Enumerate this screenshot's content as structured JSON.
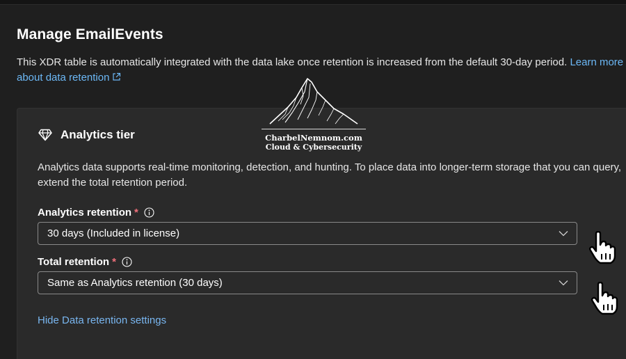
{
  "page": {
    "title": "Manage EmailEvents",
    "description": "This XDR table is automatically integrated with the data lake once retention is increased from the default 30-day period.",
    "learn_more_link": "Learn more about data retention"
  },
  "logo": {
    "line1": "CharbelNemnom.com",
    "line2": "Cloud & Cybersecurity"
  },
  "analytics": {
    "title": "Analytics tier",
    "description": "Analytics data supports real-time monitoring, detection, and hunting. To place data into longer-term storage that you can query, extend the total retention period.",
    "analytics_retention": {
      "label": "Analytics retention",
      "required_mark": "*",
      "value": "30 days (Included in license)"
    },
    "total_retention": {
      "label": "Total retention",
      "required_mark": "*",
      "value": "Same as Analytics retention (30 days)"
    },
    "hide_link": "Hide Data retention settings"
  },
  "colors": {
    "background": "#1f1f1f",
    "card": "#2a2a2a",
    "link": "#6cb8f6",
    "required": "#f1707b"
  },
  "icons": [
    "external-link-icon",
    "diamond-icon",
    "info-icon",
    "chevron-down-icon",
    "hand-pointer-icon"
  ]
}
